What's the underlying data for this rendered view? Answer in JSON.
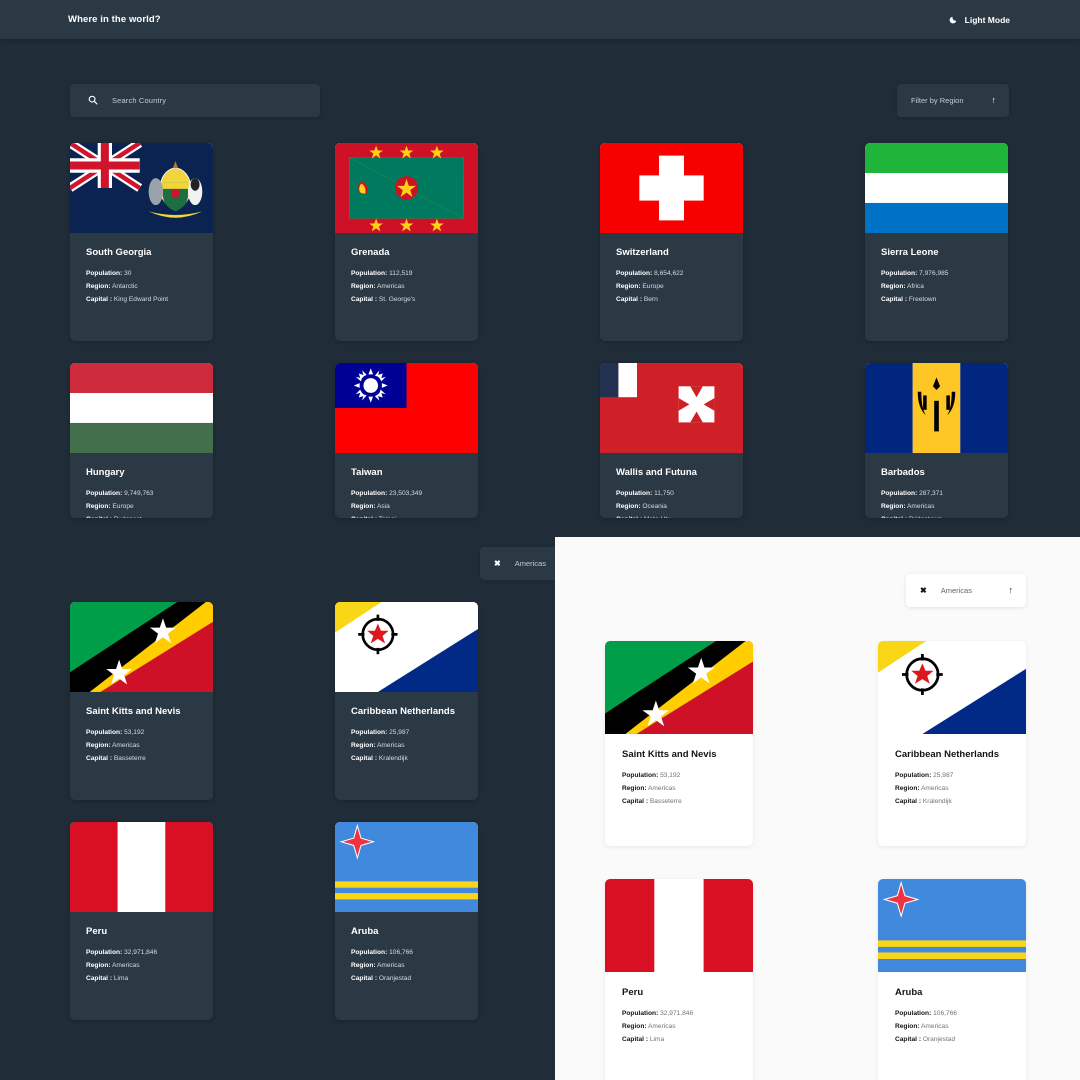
{
  "header": {
    "title": "Where in the world?",
    "mode_label": "Light Mode",
    "moon_icon": "moon-icon"
  },
  "search": {
    "placeholder": "Search Country",
    "icon": "search-icon",
    "value": ""
  },
  "filter": {
    "label": "Filter by Region",
    "arrow_icon": "arrow-up-icon"
  },
  "region_chip": {
    "close_icon": "close-icon",
    "label": "Americas",
    "arrow_icon": "arrow-up-icon"
  },
  "labels": {
    "population": "Population:",
    "region": "Region:",
    "capital": "Capital :"
  },
  "colors": {
    "dark_bg": "#202c37",
    "dark_card": "#2b3945",
    "light_bg": "#fafafa",
    "light_card": "#ffffff",
    "text_light": "#ffffff",
    "text_dark": "#111517"
  },
  "grid_row1": [
    {
      "name": "South Georgia",
      "population": "30",
      "region": "Antarctic",
      "capital": "King Edward Point",
      "flag": "south-georgia"
    },
    {
      "name": "Grenada",
      "population": "112,519",
      "region": "Americas",
      "capital": "St. George's",
      "flag": "grenada"
    },
    {
      "name": "Switzerland",
      "population": "8,654,622",
      "region": "Europe",
      "capital": "Bern",
      "flag": "switzerland"
    },
    {
      "name": "Sierra Leone",
      "population": "7,976,985",
      "region": "Africa",
      "capital": "Freetown",
      "flag": "sierra-leone"
    }
  ],
  "grid_row2": [
    {
      "name": "Hungary",
      "population": "9,749,763",
      "region": "Europe",
      "capital": "Budapest",
      "flag": "hungary"
    },
    {
      "name": "Taiwan",
      "population": "23,503,349",
      "region": "Asia",
      "capital": "Taipei",
      "flag": "taiwan"
    },
    {
      "name": "Wallis and Futuna",
      "population": "11,750",
      "region": "Oceania",
      "capital": "Mata-Utu",
      "flag": "wallis-and-futuna"
    },
    {
      "name": "Barbados",
      "population": "287,371",
      "region": "Americas",
      "capital": "Bridgetown",
      "flag": "barbados"
    }
  ],
  "grid_row3": [
    {
      "name": "Saint Kitts and Nevis",
      "population": "53,192",
      "region": "Americas",
      "capital": "Basseterre",
      "flag": "saint-kitts-and-nevis"
    },
    {
      "name": "Caribbean Netherlands",
      "population": "25,987",
      "region": "Americas",
      "capital": "Kralendijk",
      "flag": "caribbean-netherlands"
    }
  ],
  "grid_row4": [
    {
      "name": "Peru",
      "population": "32,971,846",
      "region": "Americas",
      "capital": "Lima",
      "flag": "peru"
    },
    {
      "name": "Aruba",
      "population": "106,766",
      "region": "Americas",
      "capital": "Oranjestad",
      "flag": "aruba"
    }
  ],
  "light_panel": {
    "chip": {
      "close_icon": "close-icon",
      "label": "Americas",
      "arrow_icon": "arrow-up-icon"
    },
    "cards": [
      {
        "name": "Saint Kitts and Nevis",
        "population": "53,192",
        "region": "Americas",
        "capital": "Basseterre",
        "flag": "saint-kitts-and-nevis"
      },
      {
        "name": "Caribbean Netherlands",
        "population": "25,987",
        "region": "Americas",
        "capital": "Kralendijk",
        "flag": "caribbean-netherlands"
      },
      {
        "name": "Peru",
        "population": "32,971,846",
        "region": "Americas",
        "capital": "Lima",
        "flag": "peru"
      },
      {
        "name": "Aruba",
        "population": "106,766",
        "region": "Americas",
        "capital": "Oranjestad",
        "flag": "aruba"
      }
    ]
  }
}
